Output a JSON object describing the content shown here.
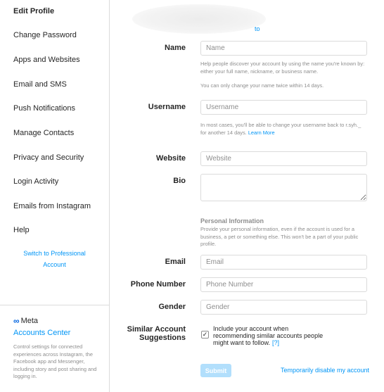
{
  "sidebar": {
    "items": [
      {
        "label": "Edit Profile"
      },
      {
        "label": "Change Password"
      },
      {
        "label": "Apps and Websites"
      },
      {
        "label": "Email and SMS"
      },
      {
        "label": "Push Notifications"
      },
      {
        "label": "Manage Contacts"
      },
      {
        "label": "Privacy and Security"
      },
      {
        "label": "Login Activity"
      },
      {
        "label": "Emails from Instagram"
      },
      {
        "label": "Help"
      }
    ],
    "switch_line1": "Switch to Professional",
    "switch_line2": "Account",
    "meta_label": "Meta",
    "accounts_center": "Accounts Center",
    "accounts_center_desc": "Control settings for connected experiences across Instagram, the Facebook app and Messenger, including story and post sharing and logging in."
  },
  "profile": {
    "change_photo_fragment": "to"
  },
  "form": {
    "name": {
      "label": "Name",
      "placeholder": "Name",
      "help1": "Help people discover your account by using the name you're known by: either your full name, nickname, or business name.",
      "help2": "You can only change your name twice within 14 days."
    },
    "username": {
      "label": "Username",
      "placeholder": "Username",
      "help": "In most cases, you'll be able to change your username back to r.syh._ for another 14 days.",
      "learn_more": "Learn More"
    },
    "website": {
      "label": "Website",
      "placeholder": "Website"
    },
    "bio": {
      "label": "Bio"
    },
    "personal_info": {
      "title": "Personal Information",
      "desc": "Provide your personal information, even if the account is used for a business, a pet or something else. This won't be a part of your public profile."
    },
    "email": {
      "label": "Email",
      "placeholder": "Email"
    },
    "phone": {
      "label": "Phone Number",
      "placeholder": "Phone Number"
    },
    "gender": {
      "label": "Gender",
      "placeholder": "Gender"
    },
    "similar": {
      "label_line1": "Similar Account",
      "label_line2": "Suggestions",
      "checkbox_text": "Include your account when recommending similar accounts people might want to follow.",
      "help_link": "[?]",
      "checked": true
    },
    "submit_label": "Submit",
    "disable_label": "Temporarily disable my account"
  },
  "colors": {
    "accent": "#0095f6",
    "submit_disabled": "#b2dffc",
    "border": "#dbdbdb",
    "muted": "#8e8e8e"
  }
}
